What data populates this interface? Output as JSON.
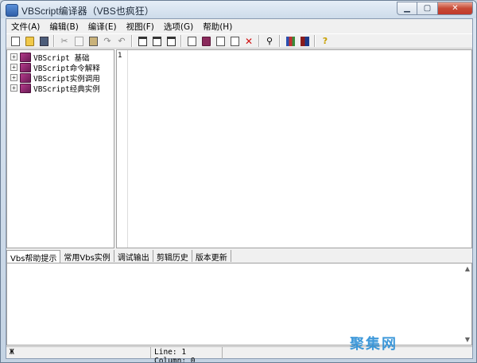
{
  "window": {
    "title": "VBScript编译器（VBS也疯狂）"
  },
  "menu": [
    "文件(A)",
    "编辑(B)",
    "编译(E)",
    "视图(F)",
    "选项(G)",
    "帮助(H)"
  ],
  "toolbar_icons": [
    "new-file-icon",
    "open-folder-icon",
    "save-icon",
    "cut-icon",
    "copy-icon",
    "paste-icon",
    "redo-icon",
    "undo-icon",
    "layout-1-icon",
    "layout-2-icon",
    "layout-3-icon",
    "book-icon",
    "books-icon",
    "new-doc-icon",
    "edit-doc-icon",
    "delete-icon",
    "find-icon",
    "library-icon",
    "bookshelf-icon",
    "help-icon"
  ],
  "tree": [
    {
      "label": "VBScript 基础"
    },
    {
      "label": "VBScript命令解释"
    },
    {
      "label": "VBScript实例调用"
    },
    {
      "label": "VBScript经典实例"
    }
  ],
  "editor": {
    "line_number": "1"
  },
  "tabs": [
    "Vbs帮助提示",
    "常用Vbs实例",
    "调试输出",
    "剪辑历史",
    "版本更新"
  ],
  "status": {
    "left": "Ж",
    "position": "Line: 1  Column: 0"
  },
  "watermark": "聚集网"
}
